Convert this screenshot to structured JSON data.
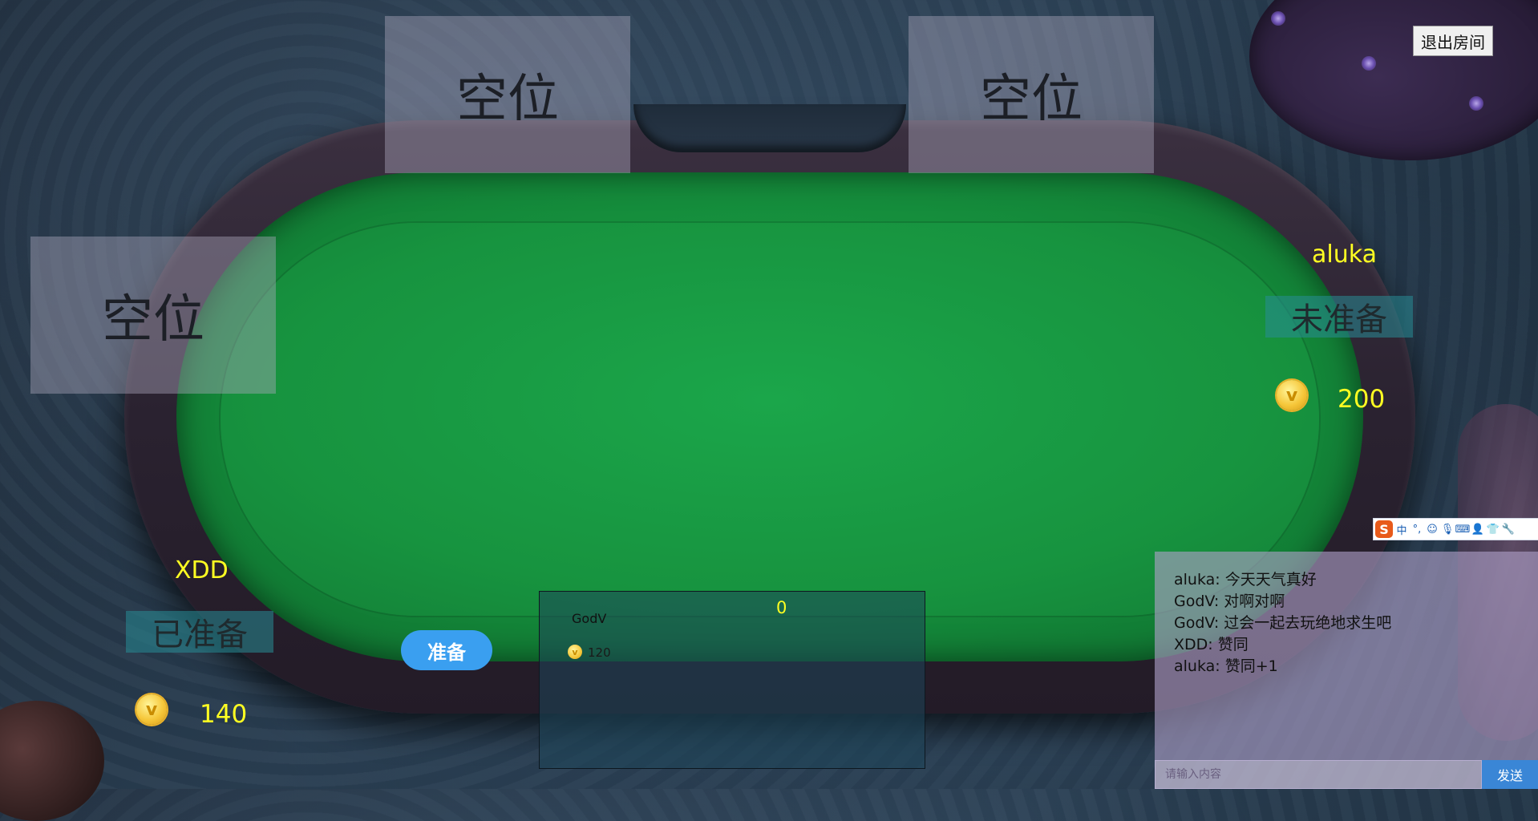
{
  "header": {
    "exit_label": "退出房间"
  },
  "seats": {
    "empty_label": "空位",
    "top_left": {
      "label": "空位"
    },
    "top_right": {
      "label": "空位"
    },
    "left": {
      "label": "空位"
    }
  },
  "players": {
    "right": {
      "name": "aluka",
      "status": "未准备",
      "coins": "200"
    },
    "bottom_left": {
      "name": "XDD",
      "status": "已准备",
      "coins": "140"
    }
  },
  "controls": {
    "ready_label": "准备"
  },
  "my_panel": {
    "pot": "0",
    "name": "GodV",
    "coins": "120"
  },
  "ime_bar": {
    "logo": "S",
    "icons": [
      "中",
      "°,",
      "smile-icon",
      "mic-icon",
      "keyboard-icon",
      "user-icon",
      "shirt-icon",
      "wrench-icon"
    ]
  },
  "chat": {
    "messages": [
      "aluka: 今天天气真好",
      "GodV: 对啊对啊",
      "GodV: 过会一起去玩绝地求生吧",
      "XDD: 赞同",
      "aluka: 赞同+1"
    ],
    "input_placeholder": "请输入内容",
    "send_label": "发送"
  },
  "colors": {
    "felt": "#17933f",
    "player_text": "#ffff22",
    "ready_button": "#3a9ff0",
    "send_button": "#3a86d6"
  }
}
